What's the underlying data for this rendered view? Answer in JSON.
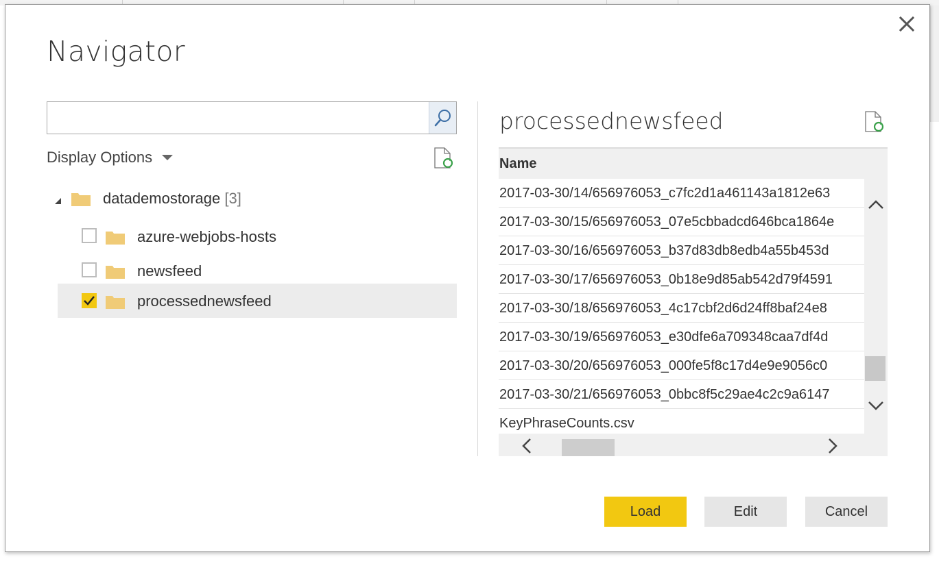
{
  "dialog": {
    "title": "Navigator",
    "search": {
      "value": "",
      "placeholder": ""
    },
    "display_options_label": "Display Options"
  },
  "tree": {
    "root": {
      "label": "datademostorage",
      "count": "[3]",
      "expanded": true
    },
    "children": [
      {
        "label": "azure-webjobs-hosts",
        "checked": false
      },
      {
        "label": "newsfeed",
        "checked": false
      },
      {
        "label": "processednewsfeed",
        "checked": true
      }
    ]
  },
  "preview": {
    "title": "processednewsfeed",
    "column_header": "Name",
    "rows": [
      "2017-03-30/14/656976053_c7fc2d1a461143a1812e63",
      "2017-03-30/15/656976053_07e5cbbadcd646bca1864e",
      "2017-03-30/16/656976053_b37d83db8edb4a55b453d",
      "2017-03-30/17/656976053_0b18e9d85ab542d79f4591",
      "2017-03-30/18/656976053_4c17cbf2d6d24ff8baf24e8",
      "2017-03-30/19/656976053_e30dfe6a709348caa7df4d",
      "2017-03-30/20/656976053_000fe5f8c17d4e9e9056c0",
      "2017-03-30/21/656976053_0bbc8f5c29ae4c2c9a6147",
      "KeyPhraseCounts.csv"
    ]
  },
  "buttons": {
    "load": "Load",
    "edit": "Edit",
    "cancel": "Cancel"
  },
  "colors": {
    "accent": "#f2c811",
    "folder": "#f0cb77",
    "search_icon": "#3c6ea5",
    "refresh_green": "#3aa14a"
  },
  "icons": [
    "close-icon",
    "search-icon",
    "refresh-icon",
    "folder-icon",
    "check-icon",
    "chevron-up-icon",
    "chevron-down-icon",
    "chevron-left-icon",
    "chevron-right-icon"
  ]
}
